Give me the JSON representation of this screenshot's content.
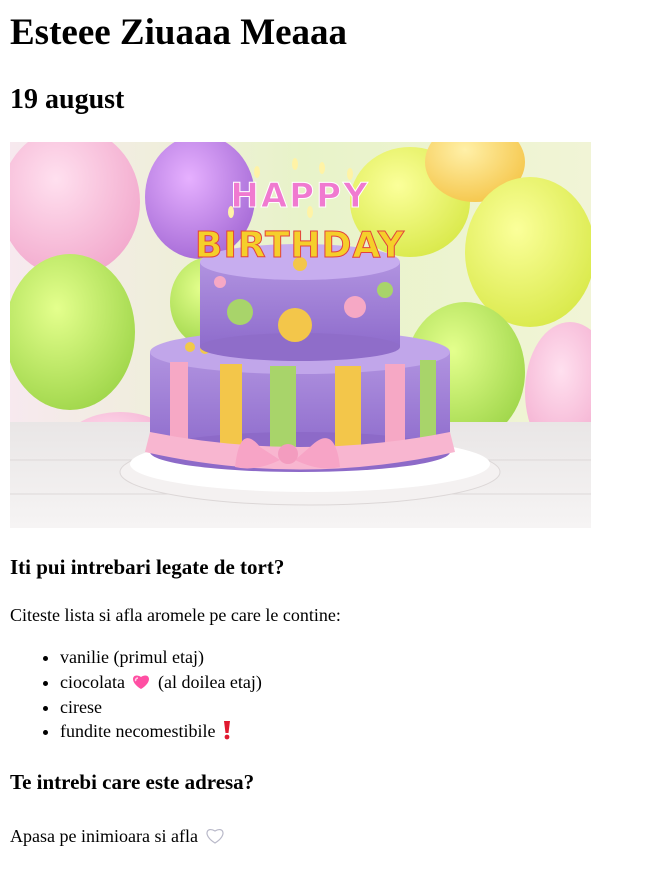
{
  "page": {
    "title": "Esteee Ziuaaa Meaaa",
    "date": "19 august",
    "photo_text": {
      "line1": "HAPPY",
      "line2": "BIRTHDAY"
    },
    "question1": "Iti pui intrebari legate de tort?",
    "intro": "Citeste lista si afla aromele pe care le contine:",
    "flavors": [
      "vanilie (primul etaj)",
      "ciocolata",
      "(al doilea etaj)",
      "cirese",
      "fundite necomestibile"
    ],
    "question2": "Te intrebi care este adresa?",
    "address_text": "Apasa pe inimioara si afla"
  },
  "colors": {
    "link": "#551a8b",
    "heart_pink": "#ff4fa3",
    "exclamation_red": "#e0192f"
  },
  "icons": {
    "pink_heart": "sparkling-heart-icon",
    "exclamation": "red-exclamation-icon",
    "white_heart": "white-heart-icon"
  }
}
